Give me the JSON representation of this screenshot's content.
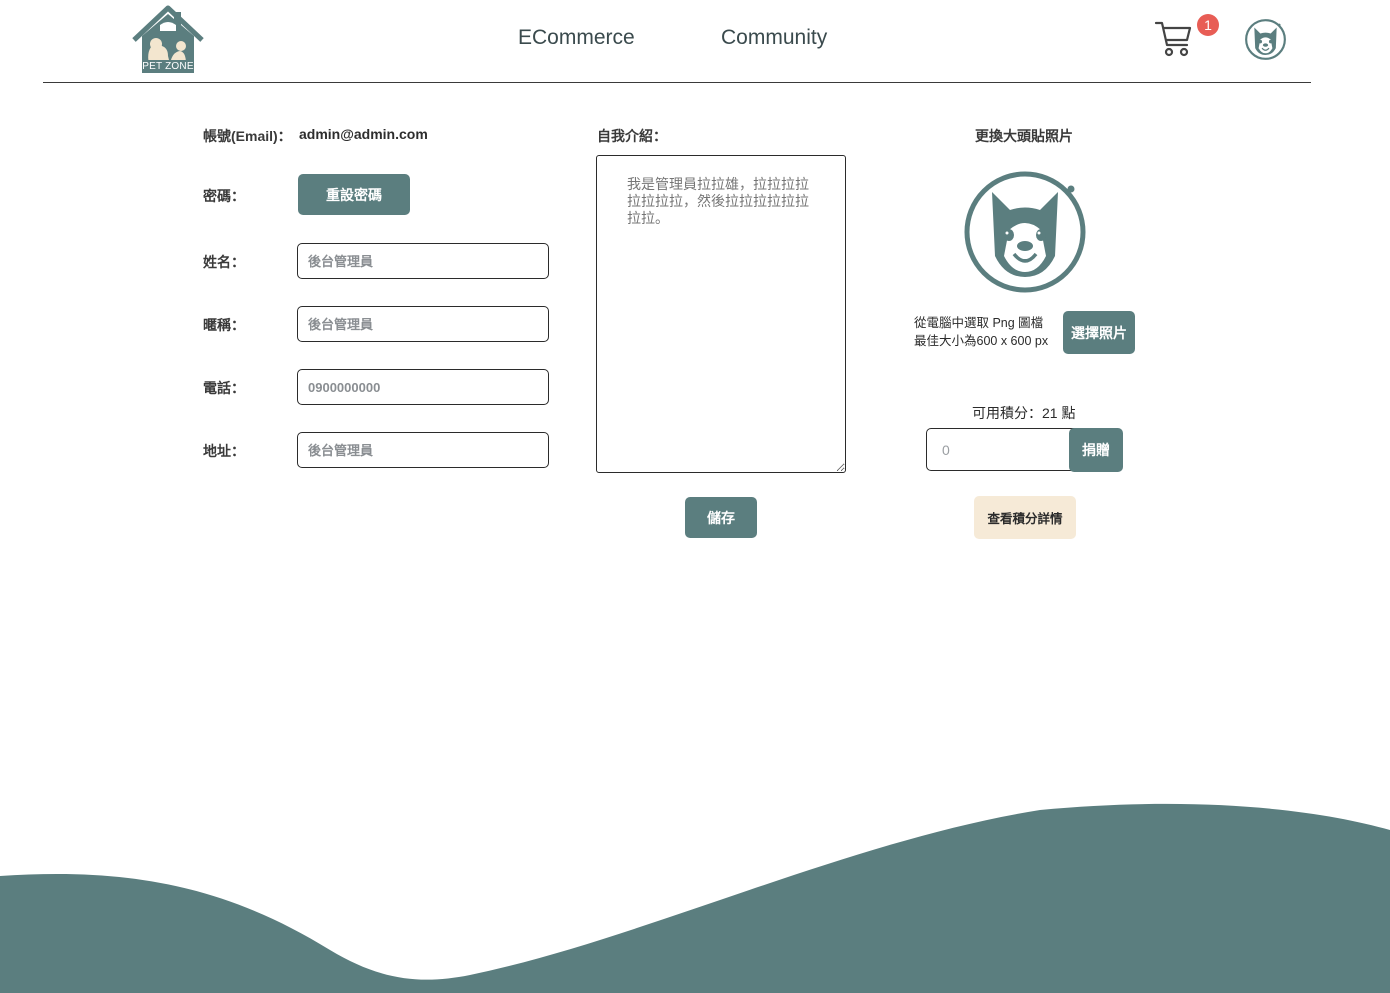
{
  "header": {
    "logo_text": "PET ZONE",
    "nav": [
      "ECommerce",
      "Community"
    ],
    "cart_count": "1"
  },
  "form": {
    "account_label": "帳號(Email)：",
    "account_value": "admin@admin.com",
    "password_label": "密碼：",
    "reset_password_label": "重設密碼",
    "name_label": "姓名：",
    "name_placeholder": "後台管理員",
    "nickname_label": "暱稱：",
    "nickname_placeholder": "後台管理員",
    "phone_label": "電話：",
    "phone_placeholder": "0900000000",
    "address_label": "地址：",
    "address_placeholder": "後台管理員"
  },
  "intro": {
    "label": "自我介紹：",
    "placeholder": "我是管理員拉拉雄，拉拉拉拉拉拉拉拉，然後拉拉拉拉拉拉拉拉。",
    "save_label": "儲存"
  },
  "photo": {
    "title": "更換大頭貼照片",
    "hint_line1": "從電腦中選取 Png 圖檔",
    "hint_line2": "最佳大小為600 x 600 px",
    "choose_label": "選擇照片"
  },
  "points": {
    "available_text": "可用積分：21 點",
    "donate_placeholder": "0",
    "donate_label": "捐贈",
    "details_label": "查看積分詳情"
  },
  "colors": {
    "teal": "#5b7e7f",
    "badge": "#e85d55",
    "cream": "#f6ead7"
  }
}
